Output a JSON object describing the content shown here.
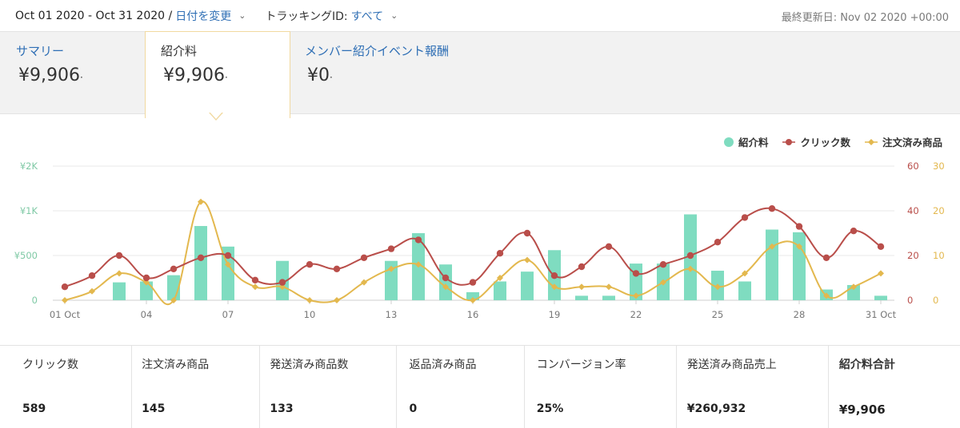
{
  "header": {
    "date_range": "Oct 01 2020 - Oct 31 2020 /",
    "change_date": "日付を変更",
    "tracking_label": "トラッキングID:",
    "tracking_value": "すべて",
    "last_updated": "最終更新日: Nov 02 2020 +00:00"
  },
  "tabs": [
    {
      "label": "サマリー",
      "value": "¥9,906"
    },
    {
      "label": "紹介料",
      "value": "¥9,906"
    },
    {
      "label": "メンバー紹介イベント報酬",
      "value": "¥0"
    }
  ],
  "tab_dot": "·",
  "legend": [
    {
      "name": "紹介料",
      "color": "#7fdcc0"
    },
    {
      "name": "クリック数",
      "color": "#b94e4a"
    },
    {
      "name": "注文済み商品",
      "color": "#e3b84e"
    }
  ],
  "chart_data": {
    "type": "bar",
    "categories": [
      "01 Oct",
      "02",
      "03",
      "04",
      "05",
      "06",
      "07",
      "08",
      "09",
      "10",
      "11",
      "12",
      "13",
      "14",
      "15",
      "16",
      "17",
      "18",
      "19",
      "20",
      "21",
      "22",
      "23",
      "24",
      "25",
      "26",
      "27",
      "28",
      "29",
      "30",
      "31 Oct"
    ],
    "x_tick_labels": [
      "01 Oct",
      "04",
      "07",
      "10",
      "13",
      "16",
      "19",
      "22",
      "25",
      "28",
      "31 Oct"
    ],
    "left_axis": {
      "ticks": [
        "0",
        "¥500",
        "¥1K",
        "¥2K"
      ],
      "color": "#7fc9a5"
    },
    "right_axis_1": {
      "ticks": [
        "0",
        "20",
        "40",
        "60"
      ],
      "color": "#b94e4a"
    },
    "right_axis_2": {
      "ticks": [
        "0",
        "10",
        "20",
        "30"
      ],
      "color": "#e3b84e"
    },
    "series": [
      {
        "name": "紹介料",
        "axis": "left",
        "render": "bar",
        "color": "#7fdcc0",
        "values": [
          0,
          0,
          200,
          210,
          280,
          830,
          600,
          0,
          440,
          0,
          0,
          0,
          440,
          750,
          400,
          90,
          210,
          320,
          560,
          50,
          50,
          410,
          410,
          960,
          330,
          210,
          790,
          760,
          120,
          170,
          50
        ]
      },
      {
        "name": "クリック数",
        "axis": "right_1",
        "render": "line",
        "color": "#b94e4a",
        "values": [
          6,
          11,
          20,
          10,
          14,
          19,
          20,
          9,
          8,
          16,
          14,
          19,
          23,
          27,
          10,
          8,
          21,
          30,
          11,
          15,
          24,
          12,
          16,
          20,
          26,
          37,
          41,
          33,
          19,
          31,
          24
        ]
      },
      {
        "name": "注文済み商品",
        "axis": "right_2",
        "render": "line",
        "color": "#e3b84e",
        "values": [
          0,
          2,
          6,
          4,
          0,
          22,
          8,
          3,
          3,
          0,
          0,
          4,
          7,
          8,
          3,
          0,
          5,
          9,
          3,
          3,
          3,
          1,
          4,
          7,
          3,
          6,
          12,
          12,
          1,
          3,
          6
        ]
      }
    ]
  },
  "stats": [
    {
      "label": "クリック数",
      "value": "589"
    },
    {
      "label": "注文済み商品",
      "value": "145"
    },
    {
      "label": "発送済み商品数",
      "value": "133"
    },
    {
      "label": "返品済み商品",
      "value": "0"
    },
    {
      "label": "コンバージョン率",
      "value": "25%"
    },
    {
      "label": "発送済み商品売上",
      "value": "¥260,932"
    },
    {
      "label": "紹介料合計",
      "value": "¥9,906"
    }
  ]
}
